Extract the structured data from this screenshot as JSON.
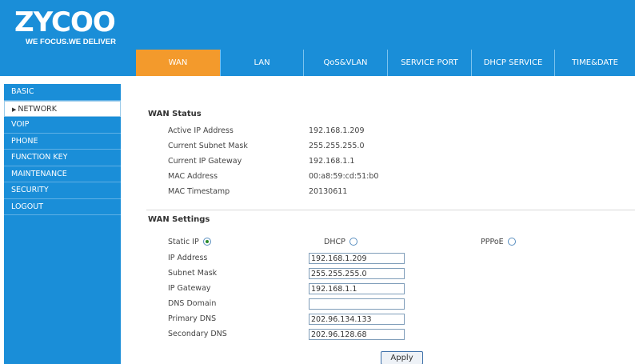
{
  "brand": {
    "logo_text": "ZYCOO",
    "slogan": "WE FOCUS.WE DELIVER"
  },
  "nav": {
    "tabs": [
      {
        "label": "WAN",
        "active": true
      },
      {
        "label": "LAN"
      },
      {
        "label": "QoS&VLAN"
      },
      {
        "label": "SERVICE PORT"
      },
      {
        "label": "DHCP SERVICE"
      },
      {
        "label": "TIME&DATE"
      }
    ]
  },
  "sidebar": {
    "items": [
      {
        "label": "BASIC"
      },
      {
        "label": "NETWORK",
        "active": true
      },
      {
        "label": "VOIP"
      },
      {
        "label": "PHONE"
      },
      {
        "label": "FUNCTION KEY"
      },
      {
        "label": "MAINTENANCE"
      },
      {
        "label": "SECURITY"
      },
      {
        "label": "LOGOUT"
      }
    ]
  },
  "wan_status": {
    "title": "WAN Status",
    "rows": [
      {
        "label": "Active IP Address",
        "value": "192.168.1.209"
      },
      {
        "label": "Current Subnet Mask",
        "value": "255.255.255.0"
      },
      {
        "label": "Current IP Gateway",
        "value": "192.168.1.1"
      },
      {
        "label": "MAC Address",
        "value": "00:a8:59:cd:51:b0"
      },
      {
        "label": "MAC Timestamp",
        "value": "20130611"
      }
    ]
  },
  "wan_settings": {
    "title": "WAN Settings",
    "modes": [
      {
        "label": "Static IP",
        "checked": true
      },
      {
        "label": "DHCP",
        "checked": false
      },
      {
        "label": "PPPoE",
        "checked": false
      }
    ],
    "fields": [
      {
        "label": "IP Address",
        "value": "192.168.1.209"
      },
      {
        "label": "Subnet Mask",
        "value": "255.255.255.0"
      },
      {
        "label": "IP Gateway",
        "value": "192.168.1.1"
      },
      {
        "label": "DNS Domain",
        "value": ""
      },
      {
        "label": "Primary DNS",
        "value": "202.96.134.133"
      },
      {
        "label": "Secondary DNS",
        "value": "202.96.128.68"
      }
    ],
    "apply_label": "Apply"
  },
  "colors": {
    "header_blue": "#1a8ed8",
    "active_tab_orange": "#f39a2c"
  }
}
